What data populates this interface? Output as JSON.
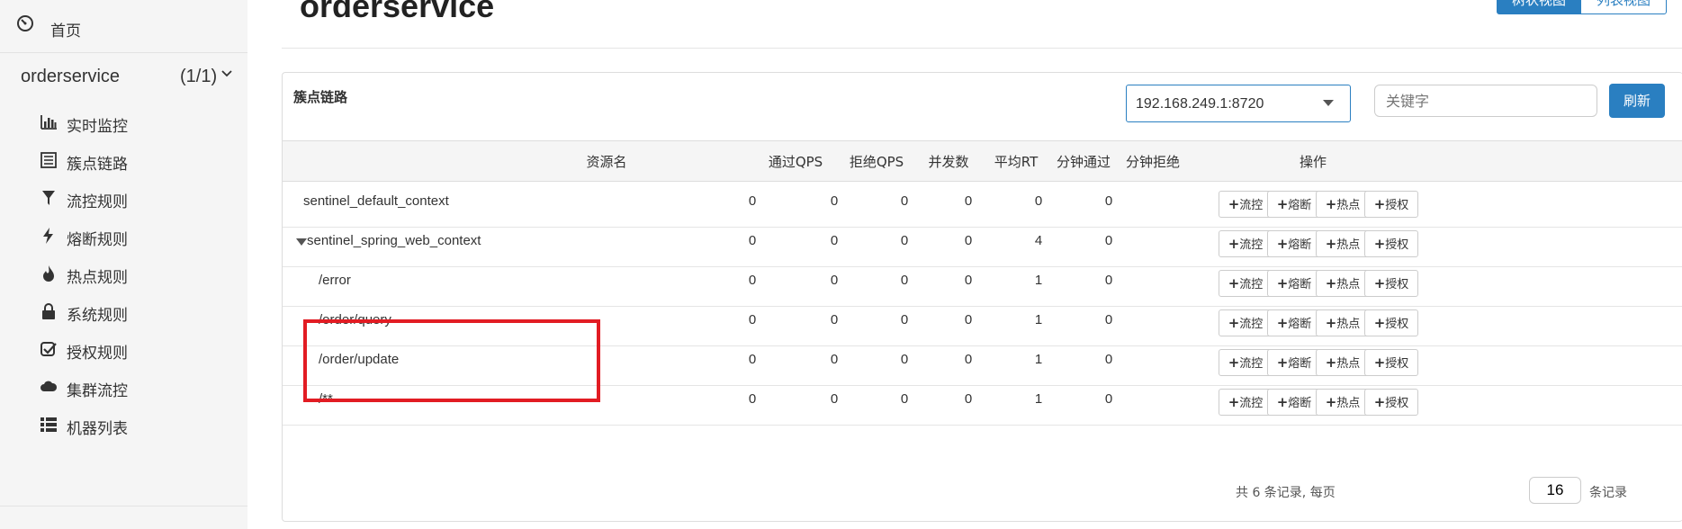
{
  "sidebar": {
    "home_label": "首页",
    "app_name": "orderservice",
    "app_count": "(1/1)",
    "items": [
      {
        "label": "实时监控",
        "icon": "bar-chart-icon"
      },
      {
        "label": "簇点链路",
        "icon": "list-icon"
      },
      {
        "label": "流控规则",
        "icon": "filter-icon"
      },
      {
        "label": "熔断规则",
        "icon": "bolt-icon"
      },
      {
        "label": "热点规则",
        "icon": "fire-icon"
      },
      {
        "label": "系统规则",
        "icon": "lock-icon"
      },
      {
        "label": "授权规则",
        "icon": "check-square-icon"
      },
      {
        "label": "集群流控",
        "icon": "cloud-icon"
      },
      {
        "label": "机器列表",
        "icon": "th-list-icon"
      }
    ]
  },
  "header": {
    "title": "orderservice",
    "view_tree": "树状视图",
    "view_list": "列表视图"
  },
  "panel": {
    "title": "簇点链路",
    "machine": "192.168.249.1:8720",
    "search_placeholder": "关键字",
    "refresh": "刷新"
  },
  "table": {
    "headers": {
      "name": "资源名",
      "pass_qps": "通过QPS",
      "block_qps": "拒绝QPS",
      "concurrency": "并发数",
      "avg_rt": "平均RT",
      "minute_pass": "分钟通过",
      "minute_block": "分钟拒绝",
      "ops": "操作"
    },
    "rows": [
      {
        "name": "sentinel_default_context",
        "pass_qps": "0",
        "block_qps": "0",
        "concurrency": "0",
        "avg_rt": "0",
        "minute_pass": "0",
        "minute_block": "0"
      },
      {
        "name": "sentinel_spring_web_context",
        "pass_qps": "0",
        "block_qps": "0",
        "concurrency": "0",
        "avg_rt": "0",
        "minute_pass": "4",
        "minute_block": "0"
      },
      {
        "name": "/error",
        "pass_qps": "0",
        "block_qps": "0",
        "concurrency": "0",
        "avg_rt": "0",
        "minute_pass": "1",
        "minute_block": "0"
      },
      {
        "name": "/order/query",
        "pass_qps": "0",
        "block_qps": "0",
        "concurrency": "0",
        "avg_rt": "0",
        "minute_pass": "1",
        "minute_block": "0"
      },
      {
        "name": "/order/update",
        "pass_qps": "0",
        "block_qps": "0",
        "concurrency": "0",
        "avg_rt": "0",
        "minute_pass": "1",
        "minute_block": "0"
      },
      {
        "name": "/**",
        "pass_qps": "0",
        "block_qps": "0",
        "concurrency": "0",
        "avg_rt": "0",
        "minute_pass": "1",
        "minute_block": "0"
      }
    ],
    "op_buttons": [
      "流控",
      "熔断",
      "热点",
      "授权"
    ]
  },
  "footer": {
    "total_text": "共 6 条记录, 每页",
    "page_size": "16",
    "suffix": "条记录"
  },
  "colors": {
    "primary": "#2a7fc1",
    "highlight": "#e21c23"
  }
}
